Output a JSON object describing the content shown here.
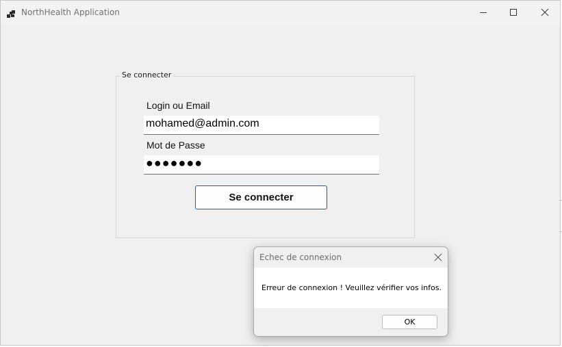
{
  "window": {
    "title": "NorthHealth Application",
    "icons": [
      "app-icon",
      "minimize-icon",
      "maximize-icon",
      "close-icon"
    ]
  },
  "login_form": {
    "group_title": "Se connecter",
    "login_label": "Login ou Email",
    "login_value": "mohamed@admin.com",
    "password_label": "Mot de Passe",
    "password_masked": "●●●●●●●",
    "submit_label": "Se connecter"
  },
  "dialog": {
    "title": "Echec de connexion",
    "message": "Erreur de connexion ! Veuillez vérifier vos infos.",
    "ok_label": "OK"
  },
  "colors": {
    "window_background": "#f0f0f0",
    "accent_border": "#0067c0",
    "input_background": "#ffffff"
  }
}
